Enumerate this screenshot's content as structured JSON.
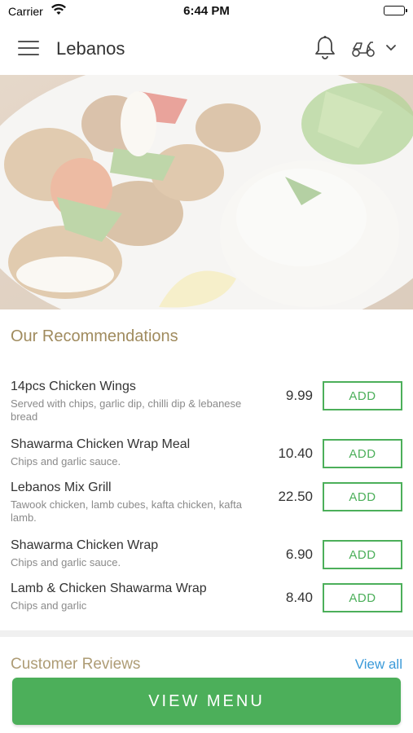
{
  "status_bar": {
    "carrier": "Carrier",
    "time": "6:44 PM"
  },
  "header": {
    "title": "Lebanos",
    "icons": [
      "menu-icon",
      "bell-icon",
      "scooter-icon",
      "chevron-down-icon"
    ]
  },
  "recommendations": {
    "title": "Our Recommendations",
    "add_label": "ADD",
    "items": [
      {
        "name": "14pcs Chicken Wings",
        "desc": "Served with chips, garlic dip, chilli dip & lebanese bread",
        "price": "9.99"
      },
      {
        "name": "Shawarma Chicken Wrap Meal",
        "desc": "Chips and garlic sauce.",
        "price": "10.40"
      },
      {
        "name": "Lebanos Mix Grill",
        "desc": "Tawook chicken, lamb cubes, kafta chicken, kafta lamb.",
        "price": "22.50"
      },
      {
        "name": "Shawarma Chicken Wrap",
        "desc": "Chips and garlic sauce.",
        "price": "6.90"
      },
      {
        "name": "Lamb & Chicken Shawarma Wrap",
        "desc": "Chips and garlic",
        "price": "8.40"
      }
    ]
  },
  "reviews": {
    "title": "Customer Reviews",
    "view_all": "View all"
  },
  "footer": {
    "view_menu": "VIEW MENU"
  },
  "colors": {
    "accent_green": "#4caf5a",
    "section_title": "#a08b5e",
    "link_blue": "#3a9ad9"
  }
}
